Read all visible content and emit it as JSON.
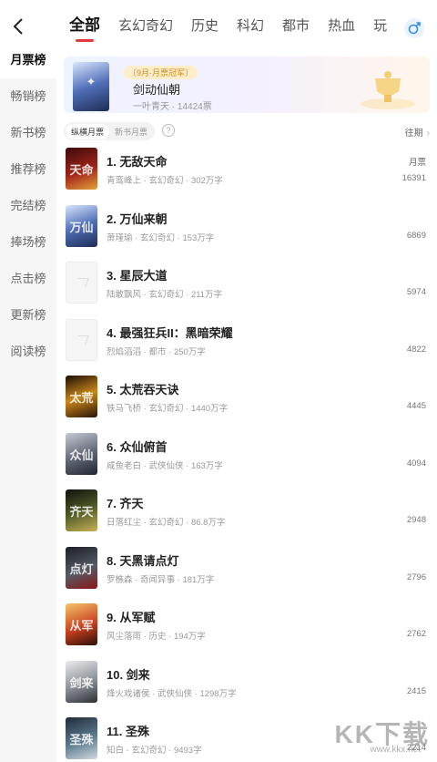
{
  "header": {
    "tabs": [
      {
        "label": "全部",
        "active": true
      },
      {
        "label": "玄幻奇幻",
        "active": false
      },
      {
        "label": "历史",
        "active": false
      },
      {
        "label": "科幻",
        "active": false
      },
      {
        "label": "都市",
        "active": false
      },
      {
        "label": "热血",
        "active": false
      },
      {
        "label": "玩",
        "active": false
      }
    ],
    "icons": {
      "back": "back-arrow-icon",
      "gender": "male-symbol-icon"
    }
  },
  "sidebar": {
    "items": [
      {
        "label": "月票榜",
        "active": true
      },
      {
        "label": "畅销榜",
        "active": false
      },
      {
        "label": "新书榜",
        "active": false
      },
      {
        "label": "推荐榜",
        "active": false
      },
      {
        "label": "完结榜",
        "active": false
      },
      {
        "label": "捧场榜",
        "active": false
      },
      {
        "label": "点击榜",
        "active": false
      },
      {
        "label": "更新榜",
        "active": false
      },
      {
        "label": "阅读榜",
        "active": false
      }
    ]
  },
  "champion": {
    "tag": "〔9月·月票冠军〕",
    "title": "剑动仙朝",
    "author": "一叶青天",
    "votes": "14424票"
  },
  "filter": {
    "options": [
      {
        "label": "纵横月票",
        "active": true
      },
      {
        "label": "新书月票",
        "active": false
      }
    ],
    "help": "?",
    "past_label": "往期",
    "vote_col_label": "月票"
  },
  "books": [
    {
      "title": "1. 无敌天命",
      "author": "青鸾峰上",
      "genre": "玄幻奇幻",
      "words": "302万字",
      "votes": "16391",
      "cover": "c-red",
      "glyph": "天命"
    },
    {
      "title": "2. 万仙来朝",
      "author": "萧瑾瑜",
      "genre": "玄幻奇幻",
      "words": "153万字",
      "votes": "6869",
      "cover": "c-blue",
      "glyph": "万仙"
    },
    {
      "title": "3. 星辰大道",
      "author": "陆敢飘风",
      "genre": "玄幻奇幻",
      "words": "211万字",
      "votes": "5974",
      "cover": "placeholder",
      "glyph": ""
    },
    {
      "title": "4. 最强狂兵II：黑暗荣耀",
      "author": "烈焰滔滔",
      "genre": "都市",
      "words": "250万字",
      "votes": "4822",
      "cover": "placeholder",
      "glyph": ""
    },
    {
      "title": "5. 太荒吞天诀",
      "author": "铁马飞桥",
      "genre": "玄幻奇幻",
      "words": "1440万字",
      "votes": "4445",
      "cover": "c-gold",
      "glyph": "太荒"
    },
    {
      "title": "6. 众仙俯首",
      "author": "咸鱼老白",
      "genre": "武侠仙侠",
      "words": "163万字",
      "votes": "4094",
      "cover": "c-grey",
      "glyph": "众仙"
    },
    {
      "title": "7. 齐天",
      "author": "日落红尘",
      "genre": "玄幻奇幻",
      "words": "86.8万字",
      "votes": "2948",
      "cover": "c-olive",
      "glyph": "齐天"
    },
    {
      "title": "8. 天黑请点灯",
      "author": "罗樵森",
      "genre": "奇闻异事",
      "words": "181万字",
      "votes": "2796",
      "cover": "c-dark",
      "glyph": "点灯"
    },
    {
      "title": "9. 从军赋",
      "author": "风尘落雨",
      "genre": "历史",
      "words": "194万字",
      "votes": "2762",
      "cover": "c-fire",
      "glyph": "从军"
    },
    {
      "title": "10. 剑来",
      "author": "烽火戏诸侯",
      "genre": "武侠仙侠",
      "words": "1298万字",
      "votes": "2415",
      "cover": "c-ink",
      "glyph": "剑来"
    },
    {
      "title": "11. 圣殊",
      "author": "知白",
      "genre": "玄幻奇幻",
      "words": "9493字",
      "votes": "2214",
      "cover": "c-cyan",
      "glyph": "圣殊"
    }
  ],
  "watermark": {
    "text": "KK下载",
    "url": "www.kkx.net"
  },
  "colors": {
    "accent": "#e63a3a",
    "sidebar_bg": "#f6f6f6",
    "muted": "#999999"
  }
}
